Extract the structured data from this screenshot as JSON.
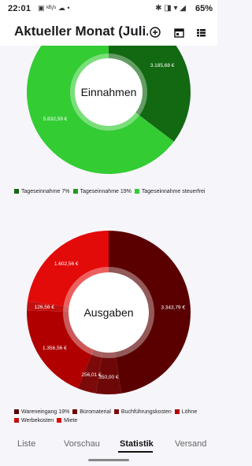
{
  "status_bar": {
    "time": "22:01",
    "left_icons": "▣ ᵏᴮ/ˢ ☁ •",
    "right_icons": "✱ ◨ ▾ ◢",
    "battery": "65%"
  },
  "app_bar": {
    "title": "Aktueller Monat (Juli...",
    "actions": [
      "add-circle-icon",
      "calendar-icon",
      "list-icon"
    ]
  },
  "charts": {
    "income": {
      "center_label": "Einnahmen",
      "legend": [
        {
          "label": "Tageseinnahme 7%",
          "color": "#126912"
        },
        {
          "label": "Tageseinnahme 19%",
          "color": "#1f9a1f"
        },
        {
          "label": "Tageseinnahme steuerfrei",
          "color": "#33cc33"
        }
      ]
    },
    "expenses": {
      "center_label": "Ausgaben",
      "legend": [
        {
          "label": "Wareneingang 19%",
          "color": "#5a0000"
        },
        {
          "label": "Büromaterial",
          "color": "#6e0808"
        },
        {
          "label": "Buchführungskosten",
          "color": "#7d0a0a"
        },
        {
          "label": "Löhne",
          "color": "#b00000"
        },
        {
          "label": "Werbekosten",
          "color": "#c21010"
        },
        {
          "label": "Miete",
          "color": "#e30a0a"
        }
      ]
    }
  },
  "chart_data": [
    {
      "type": "pie",
      "title": "Einnahmen",
      "series": [
        {
          "name": "Tageseinnahme 7%",
          "value": 3185.68,
          "label": "3.185,68 €"
        },
        {
          "name": "Tageseinnahme 19%",
          "value": 0,
          "label": ""
        },
        {
          "name": "Tageseinnahme steuerfrei",
          "value": 5832.59,
          "label": "5.832,59 €"
        }
      ]
    },
    {
      "type": "pie",
      "title": "Ausgaben",
      "series": [
        {
          "name": "Wareneingang 19%",
          "value": 3343.79,
          "label": "3.343,79 €"
        },
        {
          "name": "Büromaterial",
          "value": 350.0,
          "label": "350,00 €"
        },
        {
          "name": "Buchführungskosten",
          "value": 256.01,
          "label": "256,01 €"
        },
        {
          "name": "Löhne",
          "value": 1356.56,
          "label": "1.356,56 €"
        },
        {
          "name": "Werbekosten",
          "value": 126.56,
          "label": "126,56 €"
        },
        {
          "name": "Miete",
          "value": 1602.56,
          "label": "1.602,56 €"
        }
      ]
    }
  ],
  "bottom_nav": {
    "tabs": [
      {
        "label": "Liste",
        "active": false
      },
      {
        "label": "Vorschau",
        "active": false
      },
      {
        "label": "Statistik",
        "active": true
      },
      {
        "label": "Versand",
        "active": false
      }
    ]
  }
}
